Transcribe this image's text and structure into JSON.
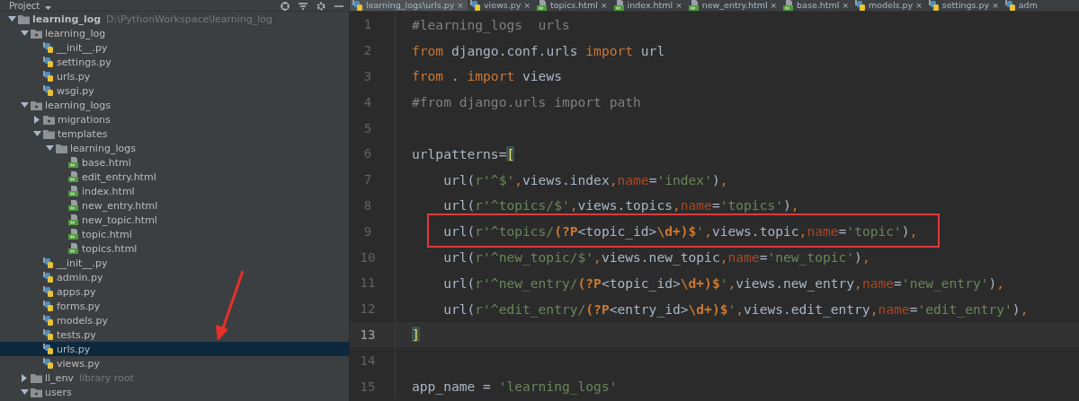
{
  "project_panel": {
    "title": "Project",
    "tree": [
      {
        "label": "learning_log",
        "note": "D:\\PythonWorkspace\\learning_log",
        "kind": "folder",
        "expanded": true,
        "selected": false,
        "children": [
          {
            "label": "learning_log",
            "kind": "package",
            "expanded": true,
            "selected": false,
            "children": [
              {
                "label": "__init__.py",
                "kind": "python",
                "selected": false
              },
              {
                "label": "settings.py",
                "kind": "python",
                "selected": false
              },
              {
                "label": "urls.py",
                "kind": "python",
                "selected": false
              },
              {
                "label": "wsgi.py",
                "kind": "python",
                "selected": false
              }
            ]
          },
          {
            "label": "learning_logs",
            "kind": "package",
            "expanded": true,
            "selected": false,
            "children": [
              {
                "label": "migrations",
                "kind": "package",
                "expanded": false,
                "selected": false
              },
              {
                "label": "templates",
                "kind": "folder",
                "expanded": true,
                "selected": false,
                "children": [
                  {
                    "label": "learning_logs",
                    "kind": "folder",
                    "expanded": true,
                    "selected": false,
                    "children": [
                      {
                        "label": "base.html",
                        "kind": "html",
                        "selected": false
                      },
                      {
                        "label": "edit_entry.html",
                        "kind": "html",
                        "selected": false
                      },
                      {
                        "label": "index.html",
                        "kind": "html",
                        "selected": false
                      },
                      {
                        "label": "new_entry.html",
                        "kind": "html",
                        "selected": false
                      },
                      {
                        "label": "new_topic.html",
                        "kind": "html",
                        "selected": false
                      },
                      {
                        "label": "topic.html",
                        "kind": "html",
                        "selected": false
                      },
                      {
                        "label": "topics.html",
                        "kind": "html",
                        "selected": false
                      }
                    ]
                  }
                ]
              },
              {
                "label": "__init__.py",
                "kind": "python",
                "selected": false
              },
              {
                "label": "admin.py",
                "kind": "python",
                "selected": false
              },
              {
                "label": "apps.py",
                "kind": "python",
                "selected": false
              },
              {
                "label": "forms.py",
                "kind": "python",
                "selected": false
              },
              {
                "label": "models.py",
                "kind": "python",
                "selected": false
              },
              {
                "label": "tests.py",
                "kind": "python",
                "selected": false
              },
              {
                "label": "urls.py",
                "kind": "python",
                "selected": true
              },
              {
                "label": "views.py",
                "kind": "python",
                "selected": false
              }
            ]
          },
          {
            "label": "ll_env",
            "note": "library root",
            "kind": "folder",
            "expanded": false,
            "selected": false
          },
          {
            "label": "users",
            "kind": "package",
            "expanded": true,
            "selected": false
          }
        ]
      }
    ]
  },
  "annotation_arrow": true,
  "editor": {
    "tabs": [
      {
        "label": "learning_logs\\urls.py",
        "close": "×",
        "kind": "python",
        "selected": true
      },
      {
        "label": "views.py",
        "close": "×",
        "kind": "python",
        "selected": false
      },
      {
        "label": "topics.html",
        "close": "×",
        "kind": "html",
        "selected": false
      },
      {
        "label": "index.html",
        "close": "×",
        "kind": "html",
        "selected": false
      },
      {
        "label": "new_entry.html",
        "close": "×",
        "kind": "html",
        "selected": false
      },
      {
        "label": "base.html",
        "close": "×",
        "kind": "html",
        "selected": false
      },
      {
        "label": "models.py",
        "close": "×",
        "kind": "python",
        "selected": false
      },
      {
        "label": "settings.py",
        "close": "×",
        "kind": "python",
        "selected": false
      },
      {
        "label": "adm",
        "kind": "python",
        "selected": false
      }
    ],
    "lines": [
      {
        "number": "1",
        "current": false,
        "highlighted": false,
        "tokens": [
          {
            "kind": "comment",
            "text": "#learning_logs  urls"
          }
        ]
      },
      {
        "number": "2",
        "current": false,
        "highlighted": false,
        "tokens": [
          {
            "kind": "keyword",
            "text": "from"
          },
          {
            "kind": "plain",
            "text": " django.conf.urls "
          },
          {
            "kind": "keyword",
            "text": "import"
          },
          {
            "kind": "plain",
            "text": " url"
          }
        ]
      },
      {
        "number": "3",
        "current": false,
        "highlighted": false,
        "tokens": [
          {
            "kind": "keyword",
            "text": "from"
          },
          {
            "kind": "plain",
            "text": " . "
          },
          {
            "kind": "keyword",
            "text": "import"
          },
          {
            "kind": "plain",
            "text": " views"
          }
        ]
      },
      {
        "number": "4",
        "current": false,
        "highlighted": false,
        "tokens": [
          {
            "kind": "comment",
            "text": "#from django.urls import path"
          }
        ]
      },
      {
        "number": "5",
        "current": false,
        "highlighted": false
      },
      {
        "number": "6",
        "current": false,
        "highlighted": false,
        "tokens": [
          {
            "kind": "plain",
            "text": "urlpatterns="
          },
          {
            "kind": "bracket",
            "text": "["
          }
        ]
      },
      {
        "number": "7",
        "current": false,
        "highlighted": false,
        "tokens": [
          {
            "kind": "plain",
            "text": "    url("
          },
          {
            "kind": "string",
            "text": "r'^$'"
          },
          {
            "kind": "keyword",
            "text": ","
          },
          {
            "kind": "plain",
            "text": "views.index"
          },
          {
            "kind": "keyword",
            "text": ","
          },
          {
            "kind": "param",
            "text": "name"
          },
          {
            "kind": "plain",
            "text": "="
          },
          {
            "kind": "string",
            "text": "'index'"
          },
          {
            "kind": "plain",
            "text": ")"
          },
          {
            "kind": "keyword",
            "text": ","
          }
        ]
      },
      {
        "number": "8",
        "current": false,
        "highlighted": false,
        "tokens": [
          {
            "kind": "plain",
            "text": "    url("
          },
          {
            "kind": "string",
            "text": "r'^topics/$'"
          },
          {
            "kind": "keyword",
            "text": ","
          },
          {
            "kind": "plain",
            "text": "views.topics"
          },
          {
            "kind": "keyword",
            "text": ","
          },
          {
            "kind": "param",
            "text": "name"
          },
          {
            "kind": "plain",
            "text": "="
          },
          {
            "kind": "string",
            "text": "'topics'"
          },
          {
            "kind": "plain",
            "text": ")"
          },
          {
            "kind": "keyword",
            "text": ","
          }
        ]
      },
      {
        "number": "9",
        "current": false,
        "highlighted": true,
        "tokens": [
          {
            "kind": "plain",
            "text": "    url("
          },
          {
            "kind": "string",
            "text": "r'^topics/"
          },
          {
            "kind": "regex",
            "text": "(?P"
          },
          {
            "kind": "plain",
            "text": "<topic_id>"
          },
          {
            "kind": "regex",
            "text": "\\d+)$"
          },
          {
            "kind": "string",
            "text": "'"
          },
          {
            "kind": "keyword",
            "text": ","
          },
          {
            "kind": "plain",
            "text": "views.topic"
          },
          {
            "kind": "keyword",
            "text": ","
          },
          {
            "kind": "param",
            "text": "name"
          },
          {
            "kind": "plain",
            "text": "="
          },
          {
            "kind": "string",
            "text": "'topic'"
          },
          {
            "kind": "plain",
            "text": ")"
          },
          {
            "kind": "keyword",
            "text": ","
          }
        ]
      },
      {
        "number": "10",
        "current": false,
        "highlighted": false,
        "tokens": [
          {
            "kind": "plain",
            "text": "    url("
          },
          {
            "kind": "string",
            "text": "r'^new_topic/$'"
          },
          {
            "kind": "keyword",
            "text": ","
          },
          {
            "kind": "plain",
            "text": "views.new_topic"
          },
          {
            "kind": "keyword",
            "text": ","
          },
          {
            "kind": "param",
            "text": "name"
          },
          {
            "kind": "plain",
            "text": "="
          },
          {
            "kind": "string",
            "text": "'new_topic'"
          },
          {
            "kind": "plain",
            "text": ")"
          },
          {
            "kind": "keyword",
            "text": ","
          }
        ]
      },
      {
        "number": "11",
        "current": false,
        "highlighted": false,
        "tokens": [
          {
            "kind": "plain",
            "text": "    url("
          },
          {
            "kind": "string",
            "text": "r'^new_entry/"
          },
          {
            "kind": "regex",
            "text": "(?P"
          },
          {
            "kind": "plain",
            "text": "<topic_id>"
          },
          {
            "kind": "regex",
            "text": "\\d+)$"
          },
          {
            "kind": "string",
            "text": "'"
          },
          {
            "kind": "keyword",
            "text": ","
          },
          {
            "kind": "plain",
            "text": "views.new_entry"
          },
          {
            "kind": "keyword",
            "text": ","
          },
          {
            "kind": "param",
            "text": "name"
          },
          {
            "kind": "plain",
            "text": "="
          },
          {
            "kind": "string",
            "text": "'new_entry'"
          },
          {
            "kind": "plain",
            "text": ")"
          },
          {
            "kind": "keyword",
            "text": ","
          }
        ]
      },
      {
        "number": "12",
        "current": false,
        "highlighted": false,
        "tokens": [
          {
            "kind": "plain",
            "text": "    url("
          },
          {
            "kind": "string",
            "text": "r'^edit_entry/"
          },
          {
            "kind": "regex",
            "text": "(?P"
          },
          {
            "kind": "plain",
            "text": "<entry_id>"
          },
          {
            "kind": "regex",
            "text": "\\d+)$"
          },
          {
            "kind": "string",
            "text": "'"
          },
          {
            "kind": "keyword",
            "text": ","
          },
          {
            "kind": "plain",
            "text": "views.edit_entry"
          },
          {
            "kind": "keyword",
            "text": ","
          },
          {
            "kind": "param",
            "text": "name"
          },
          {
            "kind": "plain",
            "text": "="
          },
          {
            "kind": "string",
            "text": "'edit_entry'"
          },
          {
            "kind": "plain",
            "text": ")"
          },
          {
            "kind": "keyword",
            "text": ","
          }
        ]
      },
      {
        "number": "13",
        "current": true,
        "highlighted": false,
        "tokens": [
          {
            "kind": "bracket",
            "text": "]"
          }
        ]
      },
      {
        "number": "14",
        "current": false,
        "highlighted": false
      },
      {
        "number": "15",
        "current": false,
        "highlighted": false,
        "tokens": [
          {
            "kind": "plain",
            "text": "app_name = "
          },
          {
            "kind": "string",
            "text": "'learning_logs'"
          }
        ]
      }
    ]
  }
}
